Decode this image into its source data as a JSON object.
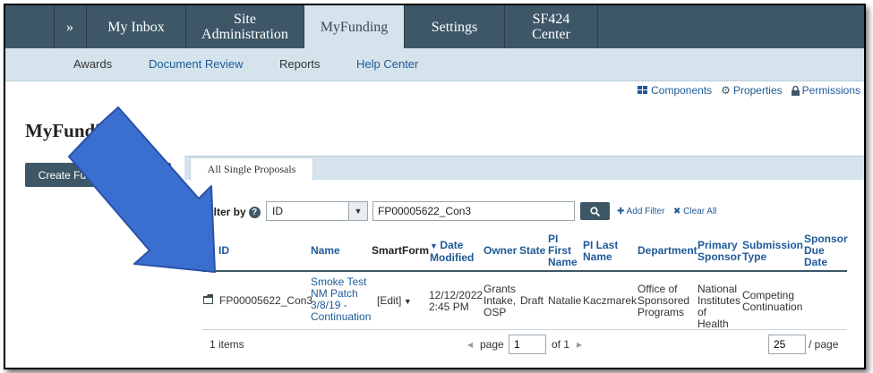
{
  "topnav": {
    "expand_glyph": "»",
    "tabs": [
      {
        "label": "My Inbox"
      },
      {
        "label": "Site Administration"
      },
      {
        "label": "MyFunding"
      },
      {
        "label": "Settings"
      },
      {
        "label": "SF424 Center"
      }
    ]
  },
  "subnav": {
    "items": [
      "Awards",
      "Document Review",
      "Reports",
      "Help Center"
    ]
  },
  "page_links": {
    "components": "Components",
    "properties": "Properties",
    "permissions": "Permissions"
  },
  "page": {
    "title": "MyFunding",
    "create_button": "Create Funding Proposal"
  },
  "panel": {
    "tab_label": "All Single Proposals",
    "filter_label": "Filter by",
    "filter_field": "ID",
    "filter_value": "FP00005622_Con3",
    "search_icon": "search-icon",
    "add_filter": "Add Filter",
    "clear_all": "Clear All"
  },
  "table": {
    "columns": [
      "ID",
      "Name",
      "SmartForm",
      "Date Modified",
      "Owner",
      "State",
      "PI First Name",
      "PI Last Name",
      "Department",
      "Primary Sponsor",
      "Submission Type",
      "Sponsor Due Date"
    ],
    "rows": [
      {
        "id": "FP00005622_Con3",
        "name": "Smoke Test NM Patch 3/8/19 - Continuation",
        "smartform": "[Edit]",
        "date_modified": "12/12/2022 2:45 PM",
        "owner": "Grants Intake, OSP",
        "state": "Draft",
        "pi_first": "Natalie",
        "pi_last": "Kaczmarek",
        "department": "Office of Sponsored Programs",
        "primary_sponsor": "National Institutes of Health",
        "submission_type": "Competing Continuation",
        "sponsor_due_date": ""
      }
    ]
  },
  "footer": {
    "items_count": "1 items",
    "page_label": "page",
    "page_value": "1",
    "of_label": "of 1",
    "per_page_value": "25",
    "per_page_label": "/ page"
  },
  "colors": {
    "nav_dark": "#3e5767",
    "nav_light": "#d5e4ec",
    "link": "#1f5a98",
    "arrow_fill": "#3a6fd0"
  }
}
